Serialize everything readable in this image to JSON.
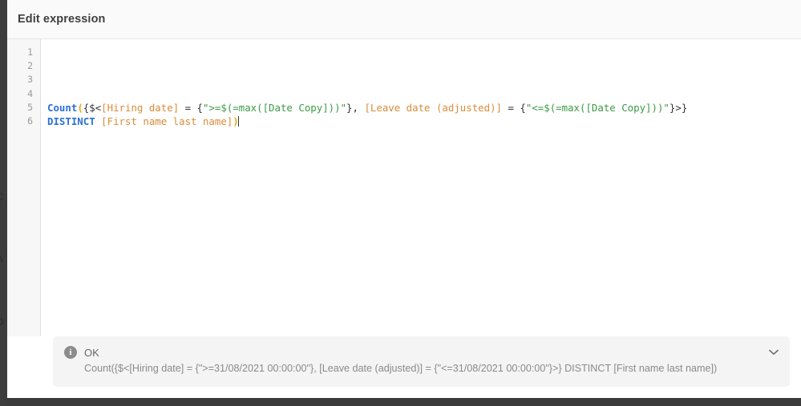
{
  "window": {
    "title": "Edit expression"
  },
  "editor": {
    "gutter_lines": [
      "1",
      "2",
      "3",
      "4",
      "5",
      "6"
    ],
    "lines": [
      {
        "tokens": []
      },
      {
        "tokens": []
      },
      {
        "tokens": []
      },
      {
        "tokens": []
      },
      {
        "tokens": [
          {
            "text": "Count",
            "type": "fn"
          },
          {
            "text": "(",
            "type": "paren"
          },
          {
            "text": "{$<",
            "type": "plain"
          },
          {
            "text": "[Hiring date]",
            "type": "field"
          },
          {
            "text": " = {",
            "type": "plain"
          },
          {
            "text": "\">=$(=max([Date Copy]))\"",
            "type": "str"
          },
          {
            "text": "}, ",
            "type": "plain"
          },
          {
            "text": "[Leave date (adjusted)]",
            "type": "field"
          },
          {
            "text": " = {",
            "type": "plain"
          },
          {
            "text": "\"<=$(=max([Date Copy]))\"",
            "type": "str"
          },
          {
            "text": "}>}",
            "type": "plain"
          }
        ]
      },
      {
        "tokens": [
          {
            "text": "DISTINCT",
            "type": "kw"
          },
          {
            "text": " ",
            "type": "plain"
          },
          {
            "text": "[First name last name]",
            "type": "field"
          },
          {
            "text": ")",
            "type": "paren"
          }
        ]
      }
    ]
  },
  "status": {
    "icon": "info-icon",
    "label": "OK",
    "preview": "Count({$<[Hiring date] = {\">=31/08/2021 00:00:00\"}, [Leave date (adjusted)] = {\"<=31/08/2021 00:00:00\"}>} DISTINCT [First name last name])",
    "expand_icon": "chevron-down-icon"
  },
  "background": {
    "glyphs": [
      "C",
      "A",
      "D"
    ]
  },
  "colors": {
    "function": "#2a6fd6",
    "field": "#d98b3a",
    "string": "#3c9a46",
    "paren": "#e6a817",
    "header_bg": "#fafafa",
    "panel_bg": "#f4f4f4"
  }
}
